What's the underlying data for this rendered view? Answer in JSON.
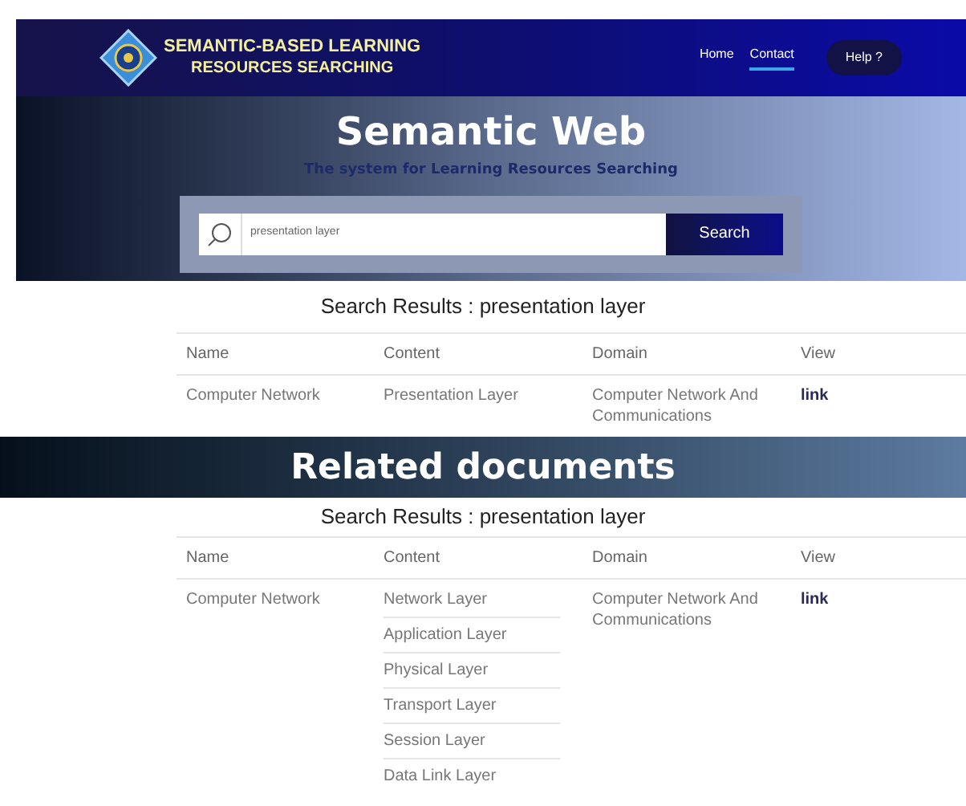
{
  "header": {
    "title_line_1": "SEMANTIC-BASED LEARNING",
    "title_line_2": "RESOURCES SEARCHING",
    "nav": [
      {
        "label": "Home",
        "selected": false
      },
      {
        "label": "Contact",
        "selected": true
      }
    ],
    "help_button": "Help ?"
  },
  "hero": {
    "title": "Semantic Web",
    "subtitle": "The system for Learning Resources Searching",
    "search_value": "presentation layer",
    "search_button": "Search"
  },
  "results": {
    "heading": "Search Results : presentation layer",
    "columns": [
      "Name",
      "Content",
      "Domain",
      "View"
    ],
    "rows": [
      {
        "name": "Computer Network",
        "content": [
          "Presentation Layer"
        ],
        "domain": "Computer Network And Communications",
        "view": "link"
      }
    ]
  },
  "related": {
    "title": "Related documents",
    "heading": "Search Results : presentation layer",
    "columns": [
      "Name",
      "Content",
      "Domain",
      "View"
    ],
    "rows": [
      {
        "name": "Computer Network",
        "content": [
          "Network Layer",
          "Application Layer",
          "Physical Layer",
          "Transport Layer",
          "Session Layer",
          "Data Link Layer"
        ],
        "domain": "Computer Network And Communications",
        "view": "link"
      }
    ]
  }
}
